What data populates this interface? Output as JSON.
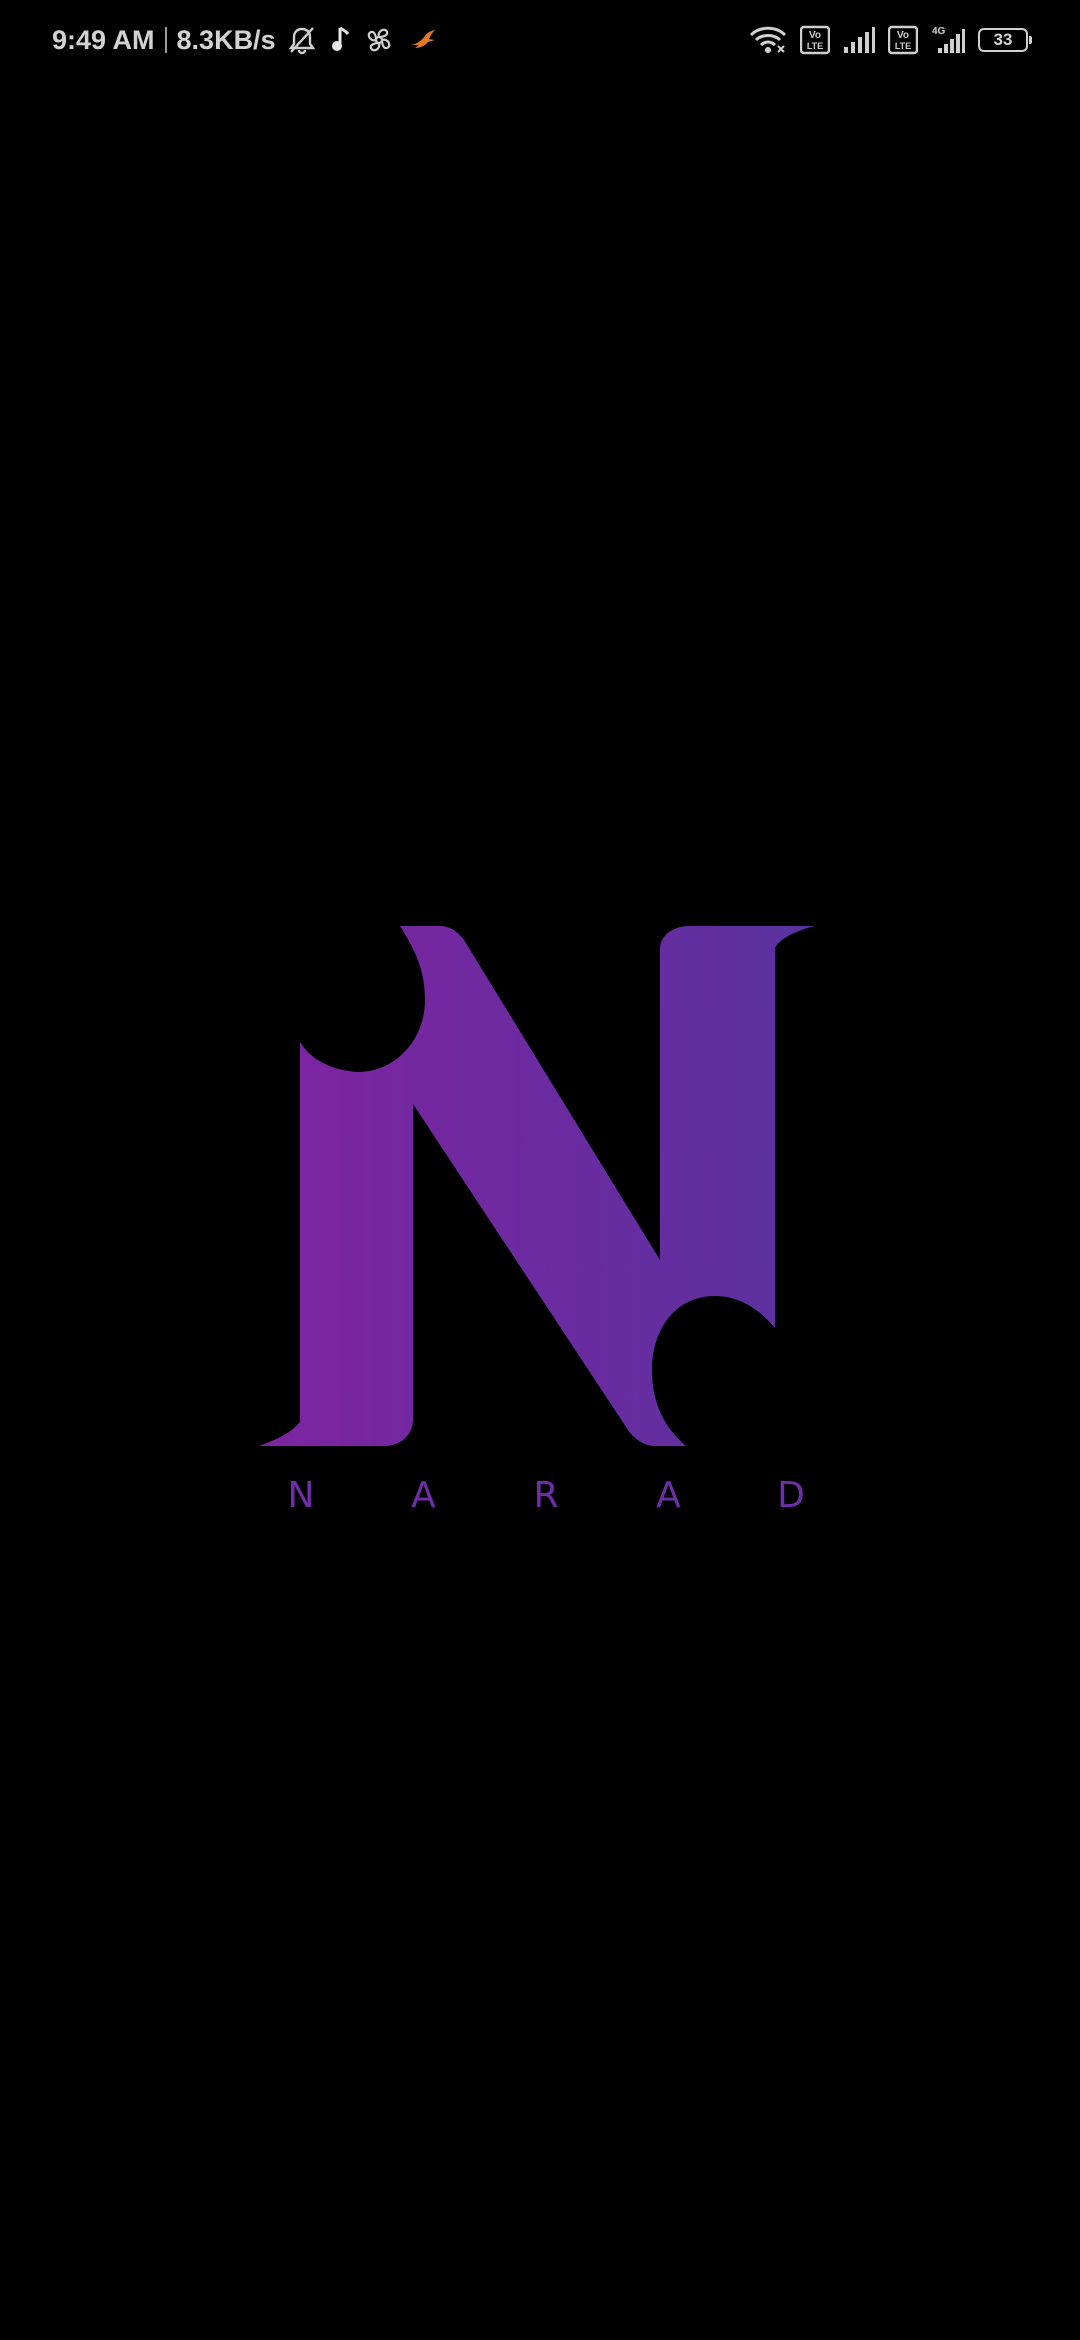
{
  "status_bar": {
    "time": "9:49 AM",
    "net_speed": "8.3KB/s",
    "battery_level": "33",
    "icons_left": [
      "mute-bell-icon",
      "music-note-icon",
      "fan-icon",
      "bird-icon"
    ],
    "icons_right": [
      "wifi-icon",
      "volte-icon",
      "signal-icon",
      "volte-icon",
      "4g-signal-icon",
      "battery-icon"
    ],
    "volte_label": "Vo\nLTE",
    "network_type": "4G"
  },
  "splash": {
    "logo_icon": "narad-n-logo",
    "brand_letters": [
      "N",
      "A",
      "R",
      "A",
      "D"
    ],
    "colors": {
      "gradient_start": "#7e24a0",
      "gradient_end": "#5a32a0",
      "brand_text": "#6f2ea8",
      "background": "#000000"
    }
  }
}
